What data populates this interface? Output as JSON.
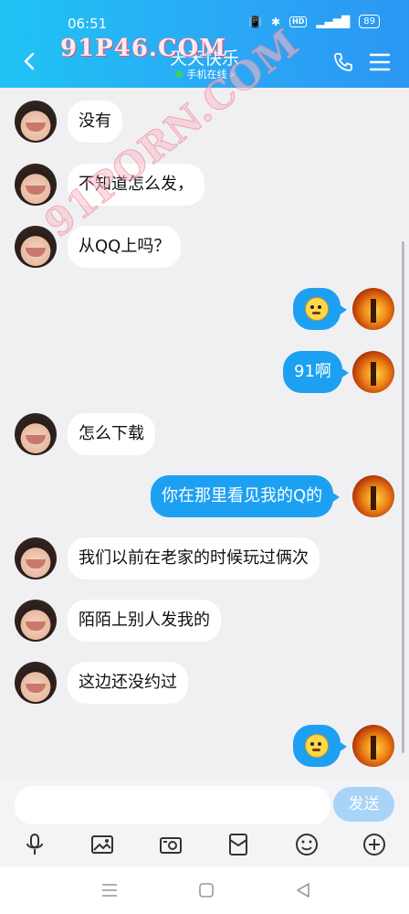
{
  "status": {
    "time": "06:51",
    "battery": "89",
    "hd": "HD"
  },
  "header": {
    "title": "天天快乐",
    "subtitle": "手机在线 ›",
    "watermark": "91P46.COM"
  },
  "watermark_diag": "91PORN.COM",
  "messages": [
    {
      "dir": "in",
      "text": "没有"
    },
    {
      "dir": "in",
      "text": "不知道怎么发，"
    },
    {
      "dir": "in",
      "text": "从QQ上吗？"
    },
    {
      "dir": "out",
      "text": "",
      "emoji": "sticker-face-emoji"
    },
    {
      "dir": "out",
      "text": "91啊"
    },
    {
      "dir": "in",
      "text": "怎么下载"
    },
    {
      "dir": "out",
      "text": "你在那里看见我的Q的"
    },
    {
      "dir": "in",
      "text": "我们以前在老家的时候玩过俩次"
    },
    {
      "dir": "in",
      "text": "陌陌上别人发我的"
    },
    {
      "dir": "in",
      "text": "这边还没约过"
    },
    {
      "dir": "out",
      "text": "",
      "emoji": "sticker-face-emoji"
    }
  ],
  "input": {
    "placeholder": "",
    "send_label": "发送"
  },
  "toolbar": [
    "microphone-icon",
    "picture-icon",
    "camera-icon",
    "red-packet-icon",
    "emoji-icon",
    "plus-icon"
  ],
  "colors": {
    "header_start": "#1fc4f5",
    "header_end": "#2b97f4",
    "bubble_out": "#1da0f2",
    "send_disabled": "#a7d4f7"
  }
}
